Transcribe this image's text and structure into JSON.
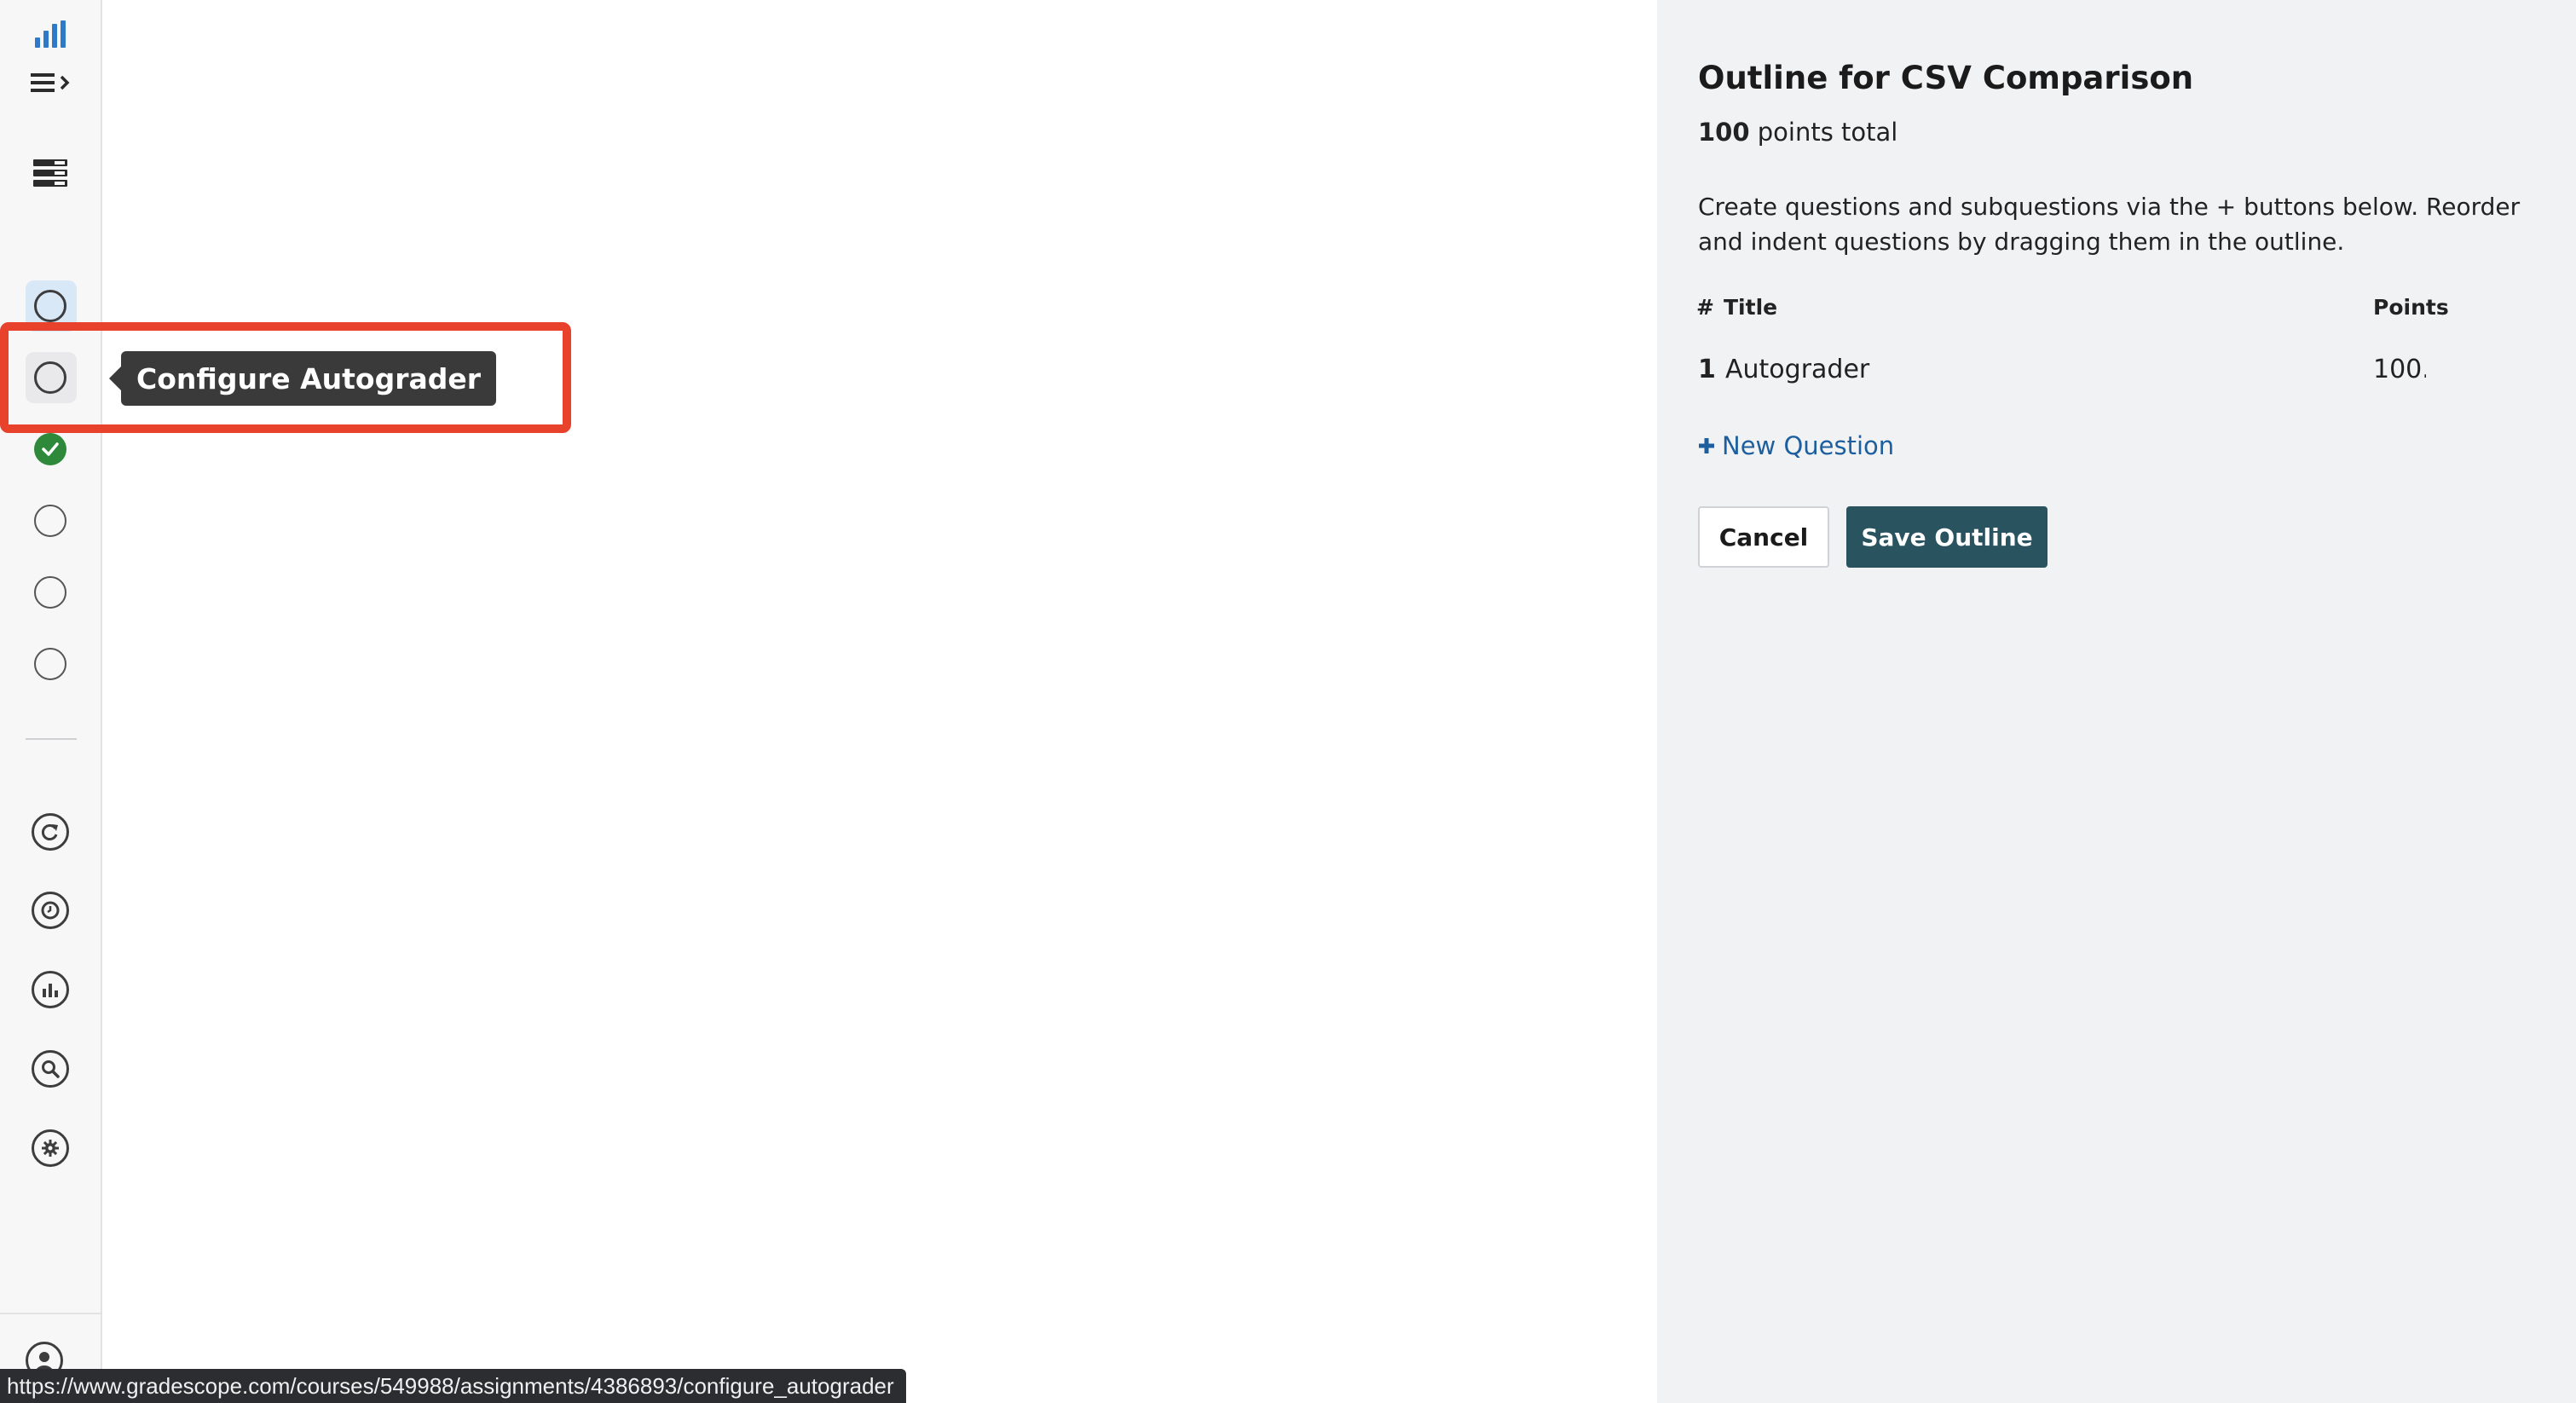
{
  "sidebar": {
    "logo_icon": "bar-chart-icon",
    "menu_icon": "menu-expand-icon",
    "assignments_icon": "list-stack-icon",
    "steps": [
      {
        "icon": "step-circle-icon",
        "state": "selected"
      },
      {
        "icon": "step-circle-icon",
        "state": "hover"
      },
      {
        "icon": "check-circle-icon",
        "state": "complete"
      },
      {
        "icon": "step-circle-icon",
        "state": "incomplete"
      },
      {
        "icon": "step-circle-icon",
        "state": "incomplete"
      },
      {
        "icon": "step-circle-icon",
        "state": "incomplete"
      }
    ],
    "tools": [
      "regrade-icon",
      "extensions-clock-icon",
      "statistics-icon",
      "search-icon",
      "settings-gear-icon"
    ],
    "user_icon": "user-avatar-icon"
  },
  "tooltip": {
    "text": "Configure Autograder"
  },
  "outline": {
    "title": "Outline for CSV Comparison",
    "points_total_value": "100",
    "points_total_label": "points total",
    "instructions": "Create questions and subquestions via the + buttons below. Reorder and indent questions by dragging them in the outline.",
    "headers": {
      "number": "#",
      "title": "Title",
      "points": "Points"
    },
    "questions": [
      {
        "number": "1",
        "title": "Autograder",
        "points": "100.0"
      }
    ],
    "new_question_label": "New Question",
    "cancel_label": "Cancel",
    "save_label": "Save Outline"
  },
  "colors": {
    "accent": "#2a5360",
    "link": "#1d5f9e",
    "highlight": "#e8412c",
    "success": "#2e8a3a"
  },
  "status_bar": {
    "url": "https://www.gradescope.com/courses/549988/assignments/4386893/configure_autograder"
  }
}
